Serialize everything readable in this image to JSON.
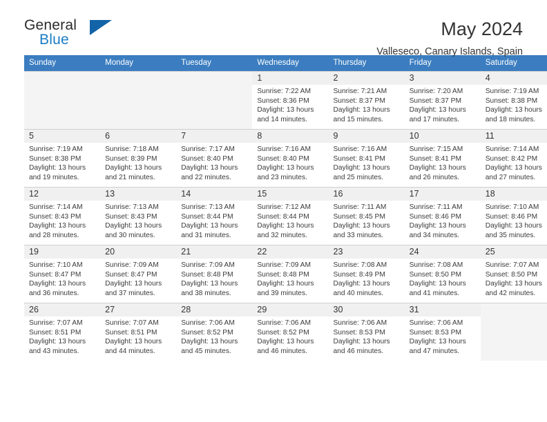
{
  "brand": {
    "name_top": "General",
    "name_bottom": "Blue",
    "triangle_color": "#1363a8",
    "blue_color": "#1a7cc4"
  },
  "header": {
    "month_title": "May 2024",
    "location": "Valleseco, Canary Islands, Spain"
  },
  "calendar": {
    "header_bg": "#3b7dc0",
    "weekday_headers": [
      "Sunday",
      "Monday",
      "Tuesday",
      "Wednesday",
      "Thursday",
      "Friday",
      "Saturday"
    ],
    "weeks": [
      [
        {
          "empty": true
        },
        {
          "empty": true
        },
        {
          "empty": true
        },
        {
          "day": "1",
          "sunrise": "Sunrise: 7:22 AM",
          "sunset": "Sunset: 8:36 PM",
          "daylight_1": "Daylight: 13 hours",
          "daylight_2": "and 14 minutes."
        },
        {
          "day": "2",
          "sunrise": "Sunrise: 7:21 AM",
          "sunset": "Sunset: 8:37 PM",
          "daylight_1": "Daylight: 13 hours",
          "daylight_2": "and 15 minutes."
        },
        {
          "day": "3",
          "sunrise": "Sunrise: 7:20 AM",
          "sunset": "Sunset: 8:37 PM",
          "daylight_1": "Daylight: 13 hours",
          "daylight_2": "and 17 minutes."
        },
        {
          "day": "4",
          "sunrise": "Sunrise: 7:19 AM",
          "sunset": "Sunset: 8:38 PM",
          "daylight_1": "Daylight: 13 hours",
          "daylight_2": "and 18 minutes."
        }
      ],
      [
        {
          "day": "5",
          "sunrise": "Sunrise: 7:19 AM",
          "sunset": "Sunset: 8:38 PM",
          "daylight_1": "Daylight: 13 hours",
          "daylight_2": "and 19 minutes."
        },
        {
          "day": "6",
          "sunrise": "Sunrise: 7:18 AM",
          "sunset": "Sunset: 8:39 PM",
          "daylight_1": "Daylight: 13 hours",
          "daylight_2": "and 21 minutes."
        },
        {
          "day": "7",
          "sunrise": "Sunrise: 7:17 AM",
          "sunset": "Sunset: 8:40 PM",
          "daylight_1": "Daylight: 13 hours",
          "daylight_2": "and 22 minutes."
        },
        {
          "day": "8",
          "sunrise": "Sunrise: 7:16 AM",
          "sunset": "Sunset: 8:40 PM",
          "daylight_1": "Daylight: 13 hours",
          "daylight_2": "and 23 minutes."
        },
        {
          "day": "9",
          "sunrise": "Sunrise: 7:16 AM",
          "sunset": "Sunset: 8:41 PM",
          "daylight_1": "Daylight: 13 hours",
          "daylight_2": "and 25 minutes."
        },
        {
          "day": "10",
          "sunrise": "Sunrise: 7:15 AM",
          "sunset": "Sunset: 8:41 PM",
          "daylight_1": "Daylight: 13 hours",
          "daylight_2": "and 26 minutes."
        },
        {
          "day": "11",
          "sunrise": "Sunrise: 7:14 AM",
          "sunset": "Sunset: 8:42 PM",
          "daylight_1": "Daylight: 13 hours",
          "daylight_2": "and 27 minutes."
        }
      ],
      [
        {
          "day": "12",
          "sunrise": "Sunrise: 7:14 AM",
          "sunset": "Sunset: 8:43 PM",
          "daylight_1": "Daylight: 13 hours",
          "daylight_2": "and 28 minutes."
        },
        {
          "day": "13",
          "sunrise": "Sunrise: 7:13 AM",
          "sunset": "Sunset: 8:43 PM",
          "daylight_1": "Daylight: 13 hours",
          "daylight_2": "and 30 minutes."
        },
        {
          "day": "14",
          "sunrise": "Sunrise: 7:13 AM",
          "sunset": "Sunset: 8:44 PM",
          "daylight_1": "Daylight: 13 hours",
          "daylight_2": "and 31 minutes."
        },
        {
          "day": "15",
          "sunrise": "Sunrise: 7:12 AM",
          "sunset": "Sunset: 8:44 PM",
          "daylight_1": "Daylight: 13 hours",
          "daylight_2": "and 32 minutes."
        },
        {
          "day": "16",
          "sunrise": "Sunrise: 7:11 AM",
          "sunset": "Sunset: 8:45 PM",
          "daylight_1": "Daylight: 13 hours",
          "daylight_2": "and 33 minutes."
        },
        {
          "day": "17",
          "sunrise": "Sunrise: 7:11 AM",
          "sunset": "Sunset: 8:46 PM",
          "daylight_1": "Daylight: 13 hours",
          "daylight_2": "and 34 minutes."
        },
        {
          "day": "18",
          "sunrise": "Sunrise: 7:10 AM",
          "sunset": "Sunset: 8:46 PM",
          "daylight_1": "Daylight: 13 hours",
          "daylight_2": "and 35 minutes."
        }
      ],
      [
        {
          "day": "19",
          "sunrise": "Sunrise: 7:10 AM",
          "sunset": "Sunset: 8:47 PM",
          "daylight_1": "Daylight: 13 hours",
          "daylight_2": "and 36 minutes."
        },
        {
          "day": "20",
          "sunrise": "Sunrise: 7:09 AM",
          "sunset": "Sunset: 8:47 PM",
          "daylight_1": "Daylight: 13 hours",
          "daylight_2": "and 37 minutes."
        },
        {
          "day": "21",
          "sunrise": "Sunrise: 7:09 AM",
          "sunset": "Sunset: 8:48 PM",
          "daylight_1": "Daylight: 13 hours",
          "daylight_2": "and 38 minutes."
        },
        {
          "day": "22",
          "sunrise": "Sunrise: 7:09 AM",
          "sunset": "Sunset: 8:48 PM",
          "daylight_1": "Daylight: 13 hours",
          "daylight_2": "and 39 minutes."
        },
        {
          "day": "23",
          "sunrise": "Sunrise: 7:08 AM",
          "sunset": "Sunset: 8:49 PM",
          "daylight_1": "Daylight: 13 hours",
          "daylight_2": "and 40 minutes."
        },
        {
          "day": "24",
          "sunrise": "Sunrise: 7:08 AM",
          "sunset": "Sunset: 8:50 PM",
          "daylight_1": "Daylight: 13 hours",
          "daylight_2": "and 41 minutes."
        },
        {
          "day": "25",
          "sunrise": "Sunrise: 7:07 AM",
          "sunset": "Sunset: 8:50 PM",
          "daylight_1": "Daylight: 13 hours",
          "daylight_2": "and 42 minutes."
        }
      ],
      [
        {
          "day": "26",
          "sunrise": "Sunrise: 7:07 AM",
          "sunset": "Sunset: 8:51 PM",
          "daylight_1": "Daylight: 13 hours",
          "daylight_2": "and 43 minutes."
        },
        {
          "day": "27",
          "sunrise": "Sunrise: 7:07 AM",
          "sunset": "Sunset: 8:51 PM",
          "daylight_1": "Daylight: 13 hours",
          "daylight_2": "and 44 minutes."
        },
        {
          "day": "28",
          "sunrise": "Sunrise: 7:06 AM",
          "sunset": "Sunset: 8:52 PM",
          "daylight_1": "Daylight: 13 hours",
          "daylight_2": "and 45 minutes."
        },
        {
          "day": "29",
          "sunrise": "Sunrise: 7:06 AM",
          "sunset": "Sunset: 8:52 PM",
          "daylight_1": "Daylight: 13 hours",
          "daylight_2": "and 46 minutes."
        },
        {
          "day": "30",
          "sunrise": "Sunrise: 7:06 AM",
          "sunset": "Sunset: 8:53 PM",
          "daylight_1": "Daylight: 13 hours",
          "daylight_2": "and 46 minutes."
        },
        {
          "day": "31",
          "sunrise": "Sunrise: 7:06 AM",
          "sunset": "Sunset: 8:53 PM",
          "daylight_1": "Daylight: 13 hours",
          "daylight_2": "and 47 minutes."
        },
        {
          "empty": true
        }
      ]
    ]
  }
}
